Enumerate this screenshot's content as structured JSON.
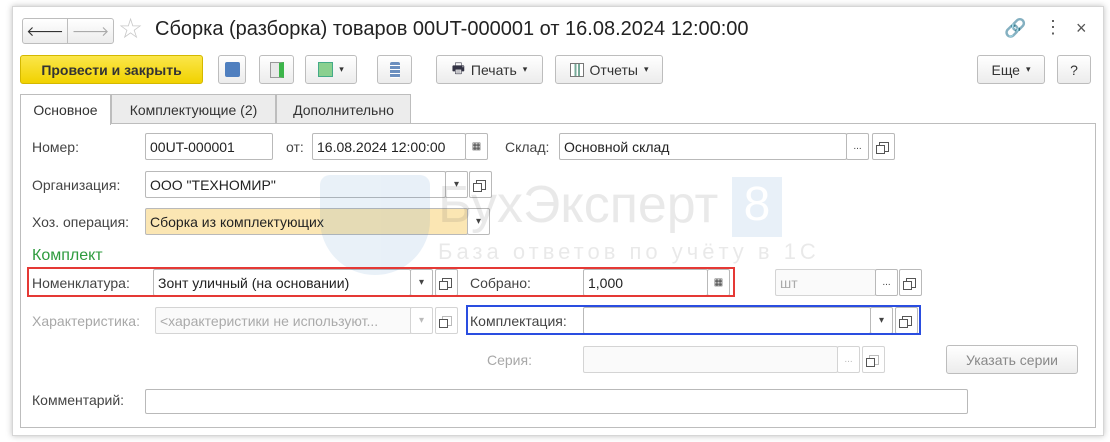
{
  "window": {
    "title": "Сборка (разборка) товаров 00UT-000001 от 16.08.2024 12:00:00"
  },
  "toolbar": {
    "post_close": "Провести и закрыть",
    "print": "Печать",
    "reports": "Отчеты",
    "more": "Еще",
    "help": "?"
  },
  "tabs": [
    {
      "label": "Основное"
    },
    {
      "label": "Комплектующие (2)"
    },
    {
      "label": "Дополнительно"
    }
  ],
  "form": {
    "number_label": "Номер:",
    "number": "00UT-000001",
    "date_label": "от:",
    "date": "16.08.2024 12:00:00",
    "warehouse_label": "Склад:",
    "warehouse": "Основной склад",
    "org_label": "Организация:",
    "org": "ООО \"ТЕХНОМИР\"",
    "op_label": "Хоз. операция:",
    "op": "Сборка из комплектующих",
    "section": "Комплект",
    "item_label": "Номенклатура:",
    "item": "Зонт уличный (на основании)",
    "qty_label": "Собрано:",
    "qty": "1,000",
    "unit": "шт",
    "char_label": "Характеристика:",
    "char": "<характеристики не используют...",
    "kit_label": "Комплектация:",
    "kit": "",
    "series_label": "Серия:",
    "series": "",
    "series_btn": "Указать серии",
    "comment_label": "Комментарий:",
    "comment": ""
  },
  "watermark": {
    "brand": "БухЭксперт",
    "num": "8",
    "tagline": "База ответов по учёту в 1С"
  },
  "colors": {
    "accent_yellow": "#f5d800",
    "section_green": "#2e9b3e",
    "highlight_red": "#e53935",
    "highlight_blue": "#2a4de0",
    "op_field": "#fbe6b3"
  }
}
